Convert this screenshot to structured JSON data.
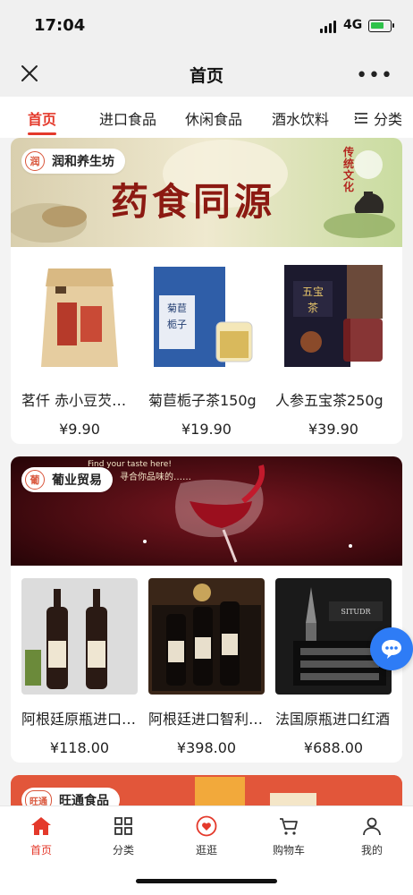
{
  "status_bar": {
    "time": "17:04",
    "network": "4G"
  },
  "navbar": {
    "title": "首页",
    "close_icon": "close-icon",
    "more_icon": "more-icon"
  },
  "tabs": [
    {
      "label": "首页",
      "active": true
    },
    {
      "label": "进口食品",
      "active": false
    },
    {
      "label": "休闲食品",
      "active": false
    },
    {
      "label": "酒水饮料",
      "active": false
    }
  ],
  "category_button": {
    "label": "分类",
    "icon": "category-list-icon"
  },
  "shops": [
    {
      "name": "润和养生坊",
      "banner_text": "药食同源",
      "banner_seal": "传统文化",
      "products": [
        {
          "name": "茗仟 赤小豆芡实薏米茶",
          "price": "¥9.90"
        },
        {
          "name": "菊苣栀子茶150g",
          "price": "¥19.90"
        },
        {
          "name": "人参五宝茶250g",
          "price": "¥39.90"
        }
      ]
    },
    {
      "name": "葡业贸易",
      "banner_text": "Find your taste here!",
      "banner_sub": "寻合你品味的……",
      "products": [
        {
          "name": "阿根廷原瓶进口红酒",
          "price": "¥118.00"
        },
        {
          "name": "阿根廷进口智利红酒",
          "price": "¥398.00"
        },
        {
          "name": "法国原瓶进口红酒",
          "price": "¥688.00"
        }
      ]
    },
    {
      "name": "旺通食品",
      "logo_text": "旺通"
    }
  ],
  "bottom_nav": [
    {
      "label": "首页",
      "icon": "home-icon",
      "active": true
    },
    {
      "label": "分类",
      "icon": "grid-icon",
      "active": false
    },
    {
      "label": "逛逛",
      "icon": "heart-icon",
      "active": false
    },
    {
      "label": "购物车",
      "icon": "cart-icon",
      "active": false
    },
    {
      "label": "我的",
      "icon": "user-icon",
      "active": false
    }
  ],
  "colors": {
    "accent": "#e4392b",
    "chat": "#2e7cf6"
  }
}
